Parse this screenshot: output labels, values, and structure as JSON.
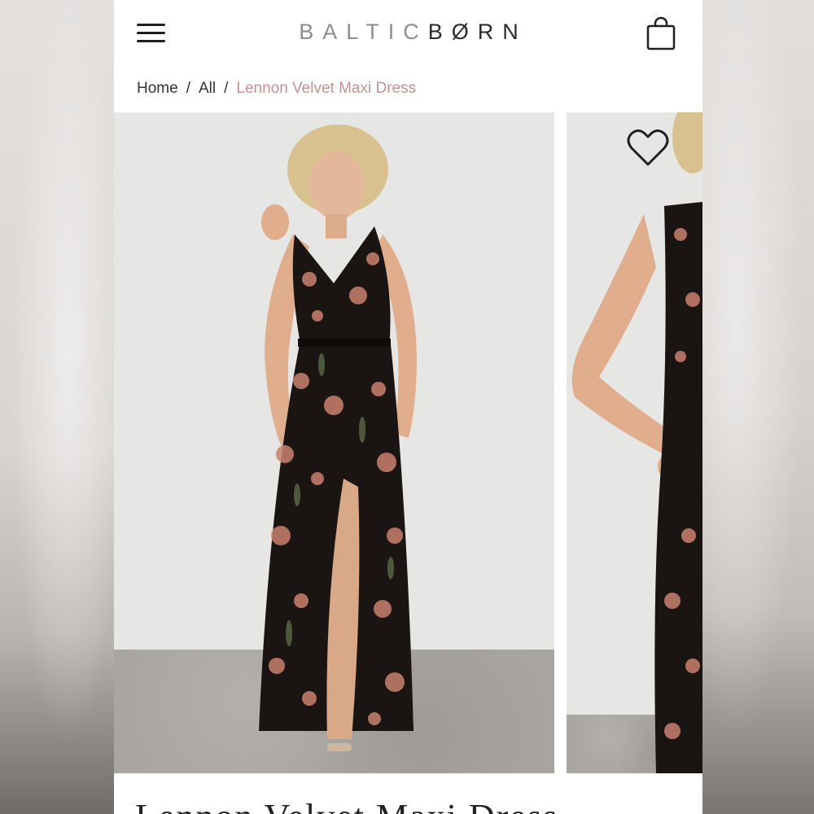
{
  "brand": {
    "part1": "BALTIC",
    "part2": "BØRN"
  },
  "breadcrumb": {
    "home": "Home",
    "all": "All",
    "current": "Lennon Velvet Maxi Dress",
    "separator": "/"
  },
  "icons": {
    "menu": "hamburger-menu-icon",
    "cart": "shopping-bag-icon",
    "favorite": "heart-outline-icon"
  },
  "product": {
    "title": "Lennon Velvet Maxi Dress"
  },
  "colors": {
    "accent": "#c49191",
    "text": "#222222",
    "brand_light": "#8e8e8e",
    "brand_dark": "#2b2b2b"
  }
}
